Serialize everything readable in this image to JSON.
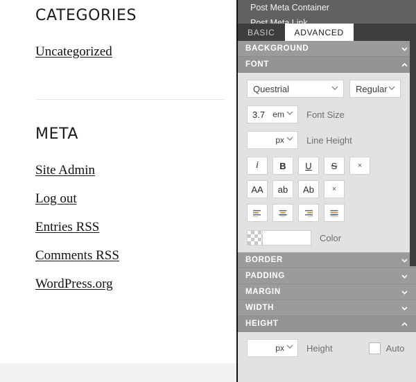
{
  "page": {
    "widgets": [
      {
        "title": "CATEGORIES",
        "links": [
          "Uncategorized"
        ]
      },
      {
        "title": "META",
        "links": [
          "Site Admin",
          "Log out",
          "Entries RSS",
          "Comments RSS",
          "WordPress.org"
        ]
      }
    ]
  },
  "panel": {
    "layers": [
      "Post Meta Container",
      "Post Meta Link"
    ],
    "tabs": [
      {
        "label": "BASIC",
        "active": false
      },
      {
        "label": "ADVANCED",
        "active": true
      }
    ],
    "sections": [
      {
        "label": "BACKGROUND",
        "open": false
      },
      {
        "label": "FONT",
        "open": true
      },
      {
        "label": "BORDER",
        "open": false
      },
      {
        "label": "PADDING",
        "open": false
      },
      {
        "label": "MARGIN",
        "open": false
      },
      {
        "label": "WIDTH",
        "open": false
      },
      {
        "label": "HEIGHT",
        "open": true
      }
    ],
    "font": {
      "family_value": "Questrial",
      "weight_value": "Regular",
      "font_size": {
        "value": "3.7",
        "unit": "em",
        "label": "Font Size"
      },
      "line_height": {
        "value": "",
        "unit": "px",
        "label": "Line Height"
      },
      "style_buttons": [
        "i",
        "B",
        "U",
        "S",
        "×"
      ],
      "transform_buttons": [
        "AA",
        "ab",
        "Ab",
        "×"
      ],
      "align_buttons": [
        "align-left",
        "align-center",
        "align-right",
        "align-justify"
      ],
      "color_label": "Color",
      "color_value": "#ffffff"
    },
    "height": {
      "value": "",
      "unit": "px",
      "label": "Height",
      "auto_label": "Auto",
      "auto_checked": false
    }
  },
  "colors": {
    "panel_bg": "#e2e2e2",
    "section_header": "#9b9b9b",
    "tabbar": "#3d3d3d",
    "layer_strip": "#616161",
    "accent_white": "#ffffff"
  }
}
